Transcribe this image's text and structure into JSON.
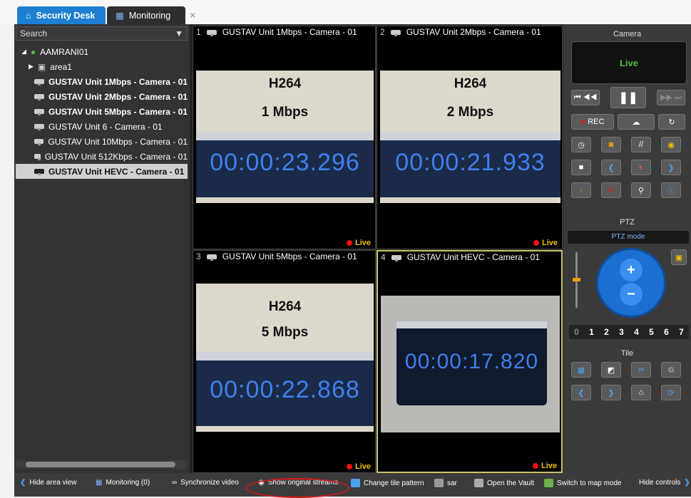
{
  "tabs": [
    {
      "label": "Security Desk",
      "icon": "home-icon"
    },
    {
      "label": "Monitoring",
      "icon": "monitoring-icon"
    }
  ],
  "search": {
    "placeholder": "Search"
  },
  "tree": {
    "root": "AAMRANI01",
    "area": "area1",
    "cameras": [
      {
        "label": "GUSTAV Unit 1Mbps - Camera - 01",
        "bold": true
      },
      {
        "label": "GUSTAV Unit 2Mbps - Camera - 01",
        "bold": true
      },
      {
        "label": "GUSTAV Unit 5Mbps - Camera - 01",
        "bold": true
      },
      {
        "label": "GUSTAV Unit 6 - Camera - 01",
        "bold": false
      },
      {
        "label": "GUSTAV Unit 10Mbps - Camera - 01",
        "bold": false
      },
      {
        "label": "GUSTAV Unit 512Kbps - Camera - 01",
        "bold": false
      },
      {
        "label": "GUSTAV Unit HEVC - Camera - 01",
        "bold": true,
        "selected": true
      }
    ]
  },
  "tiles": [
    {
      "num": "1",
      "title": "GUSTAV Unit 1Mbps - Camera - 01",
      "codec": "H264",
      "rate": "1 Mbps",
      "timestamp": "00:00:23.296",
      "status": "Live"
    },
    {
      "num": "2",
      "title": "GUSTAV Unit 2Mbps - Camera - 01",
      "codec": "H264",
      "rate": "2 Mbps",
      "timestamp": "00:00:21.933",
      "status": "Live"
    },
    {
      "num": "3",
      "title": "GUSTAV Unit 5Mbps - Camera - 01",
      "codec": "H264",
      "rate": "5 Mbps",
      "timestamp": "00:00:22.868",
      "status": "Live"
    },
    {
      "num": "4",
      "title": "GUSTAV Unit HEVC - Camera - 01",
      "timestamp": "00:00:17.820",
      "status": "Live"
    }
  ],
  "camera_panel": {
    "title": "Camera",
    "state": "Live",
    "rec_label": "REC"
  },
  "ptz_panel": {
    "title": "PTZ",
    "mode_label": "PTZ mode",
    "presets": [
      "0",
      "1",
      "2",
      "3",
      "4",
      "5",
      "6",
      "7"
    ]
  },
  "tile_panel": {
    "title": "Tile"
  },
  "bottom_bar": {
    "hide_area_view": "Hide area view",
    "monitoring": "Monitoring (0)",
    "synchronize_video": "Synchronize video",
    "show_original_streams": "Show original streams",
    "change_tile_pattern": "Change tile pattern",
    "sar": "sar",
    "open_vault": "Open the Vault",
    "switch_map": "Switch to map mode",
    "hide_controls": "Hide controls"
  },
  "colors": {
    "accent": "#1d7fd1",
    "live_green": "#4bbf3a",
    "live_yellow": "#f5c000",
    "timestamp_blue": "#3f7ff0",
    "annotation_red": "#d51818"
  }
}
